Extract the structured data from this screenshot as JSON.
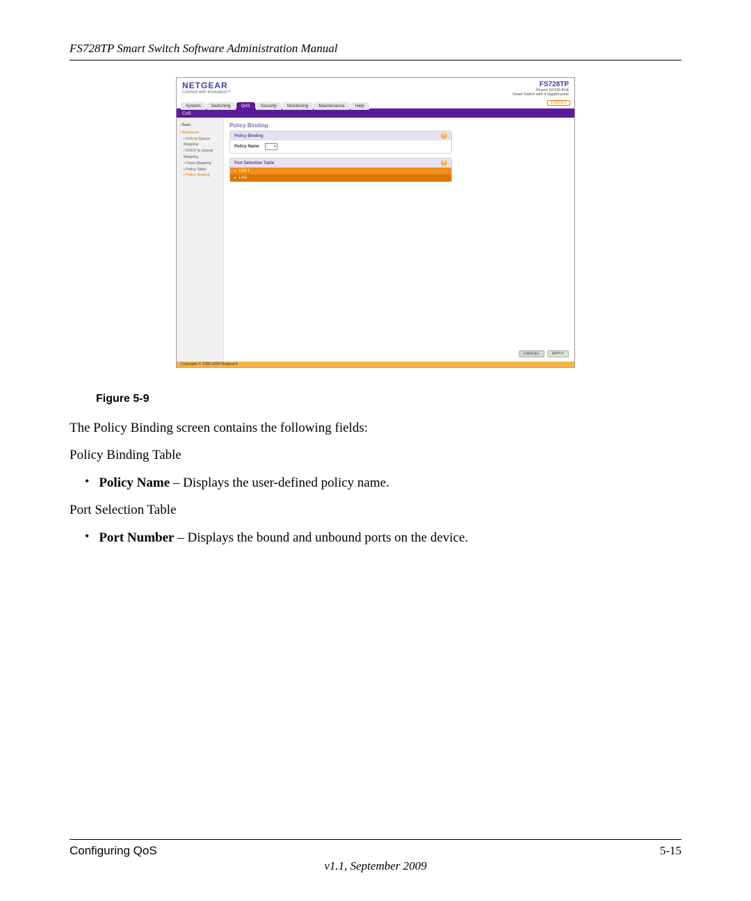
{
  "doc": {
    "header": "FS728TP Smart Switch Software Administration Manual",
    "figure_caption": "Figure 5-9",
    "intro": "The Policy Binding screen contains the following fields:",
    "section1": "Policy Binding Table",
    "bullet1_bold": "Policy Name",
    "bullet1_rest": " – Displays the user-defined policy name.",
    "section2": "Port Selection Table",
    "bullet2_bold": "Port Number",
    "bullet2_rest": " – Displays the bound and unbound ports on the device.",
    "footer_left": "Configuring QoS",
    "footer_right": "5-15",
    "version": "v1.1, September 2009"
  },
  "ui": {
    "brand": "NETGEAR",
    "brand_sub": "Connect with Innovation™",
    "model": "FS728TP",
    "model_sub1": "24-port 10/100 PoE",
    "model_sub2": "Smart Switch with 4 Gigabit ports",
    "tabs": [
      "System",
      "Switching",
      "QoS",
      "Security",
      "Monitoring",
      "Maintenance",
      "Help"
    ],
    "active_tab": "QoS",
    "logout": "LOGOUT",
    "subbar": "CoS",
    "sidebar": {
      "basic": "Basic",
      "advanced": "Advanced",
      "items": [
        "CoS to Queue Mapping",
        "DSCP to Queue Mapping",
        "Class Mapping",
        "Policy Table",
        "Policy Binding"
      ]
    },
    "main": {
      "title": "Policy Binding",
      "panel1_head": "Policy Binding",
      "policy_name_label": "Policy Name",
      "panel2_head": "Port Selection Table",
      "row_unit": "Unit 1",
      "row_lag": "LAG"
    },
    "buttons": {
      "cancel": "CANCEL",
      "apply": "APPLY"
    },
    "copyright": "Copyright © 1996-2009 Netgear®"
  }
}
